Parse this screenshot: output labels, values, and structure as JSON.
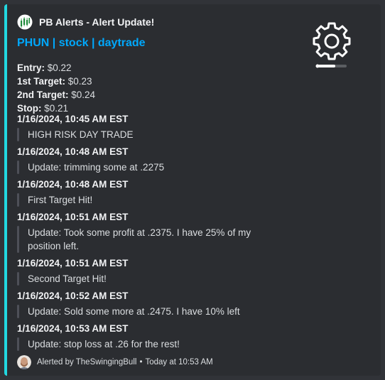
{
  "author": {
    "name": "PB Alerts - Alert Update!",
    "icon": "bull-chart-logo-icon"
  },
  "title": "PHUN | stock | daytrade",
  "thumbnail": {
    "icon": "gear-icon",
    "progress": 0.6
  },
  "fields": [
    {
      "label": "Entry:",
      "value": "$0.22"
    },
    {
      "label": "1st Target:",
      "value": "$0.23"
    },
    {
      "label": "2nd Target:",
      "value": "$0.24"
    },
    {
      "label": "Stop:",
      "value": "$0.21"
    }
  ],
  "updates": [
    {
      "time": "1/16/2024, 10:45 AM EST",
      "text": "HIGH RISK DAY TRADE"
    },
    {
      "time": "1/16/2024, 10:48 AM EST",
      "text": "Update: trimming some at .2275"
    },
    {
      "time": "1/16/2024, 10:48 AM EST",
      "text": "First Target Hit!"
    },
    {
      "time": "1/16/2024, 10:51 AM EST",
      "text": "Update: Took some profit at .2375. I have 25% of my position left."
    },
    {
      "time": "1/16/2024, 10:51 AM EST",
      "text": "Second Target Hit!"
    },
    {
      "time": "1/16/2024, 10:52 AM EST",
      "text": "Update: Sold some more at .2475. I have 10% left"
    },
    {
      "time": "1/16/2024, 10:53 AM EST",
      "text": "Update: stop loss at .26 for the rest!"
    }
  ],
  "footer": {
    "text": "Alerted by TheSwingingBull",
    "separator": "•",
    "timestamp": "Today at 10:53 AM",
    "avatar": "user-avatar"
  },
  "colors": {
    "accent_bar": "#22d7e0",
    "title_link": "#00a8fc",
    "embed_bg": "#2b2d31",
    "page_bg": "#313338"
  }
}
